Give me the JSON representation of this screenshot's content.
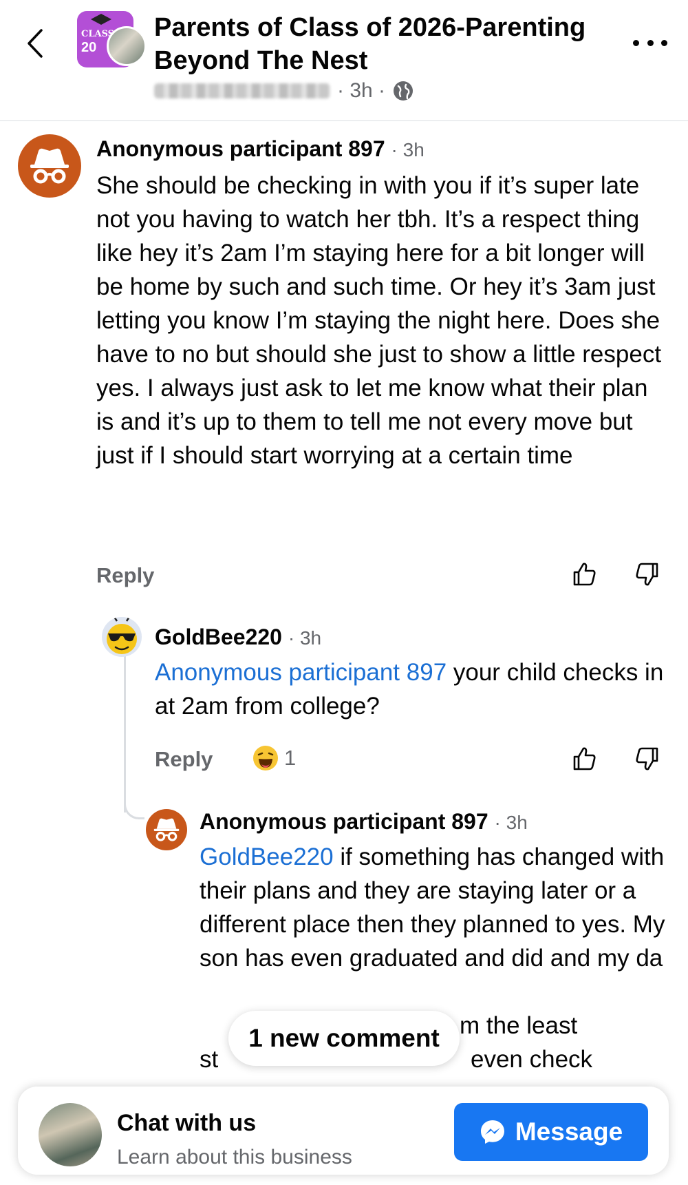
{
  "header": {
    "back_icon": "chevron-left-icon",
    "group_avatar_text": "CLASS",
    "group_avatar_year": "20",
    "title": "Parents of Class of 2026-Parenting Beyond The Nest",
    "post_time": "· 3h ·",
    "privacy_icon": "globe-icon",
    "more_icon": "more-horizontal-icon"
  },
  "comments": [
    {
      "author": "Anonymous participant 897",
      "time": "· 3h",
      "body": "She should be checking in with you if it’s super late not you having to watch her tbh. It’s a respect thing like hey it’s 2am I’m staying here for a bit longer will be home by such and such time. Or hey it’s 3am just letting you know I’m staying the night here. Does she have to no but should she just to show a little respect yes.  I always just ask to let me know what their plan is and it’s up to them to tell me not every move but just if I should start worrying at a certain time",
      "reply_label": "Reply"
    },
    {
      "author": "GoldBee220",
      "time": "· 3h",
      "mention": "Anonymous participant 897",
      "body": " your child checks in at 2am from college?",
      "reply_label": "Reply",
      "reaction_count": "1",
      "reaction_icon": "haha-emoji-icon"
    },
    {
      "author": "Anonymous participant 897",
      "time": "· 3h",
      "mention": "GoldBee220",
      "body": " if something has changed with their plans and they are staying later or a different place then they planned to yes. My son has even graduated and did and my da",
      "body_tail": "m the least",
      "body_line3a": "st",
      "body_line3b": "even check"
    }
  ],
  "new_comment_pill": "1 new comment",
  "chat_bar": {
    "title": "Chat with us",
    "subtitle": "Learn about this business",
    "button_label": "Message"
  },
  "colors": {
    "link": "#1b6fd4",
    "anon_avatar": "#c8571a",
    "message_button": "#1877f2",
    "muted": "#65676b"
  }
}
